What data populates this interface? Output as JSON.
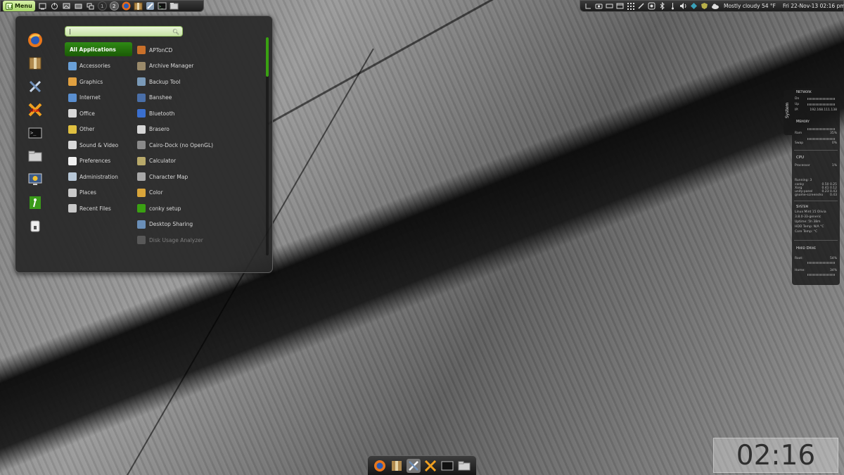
{
  "top_panel": {
    "menu_label": "Menu",
    "workspaces": [
      "1",
      "2"
    ],
    "weather": "Mostly cloudy 54 °F",
    "datetime": "Fri 22-Nov-13 02:16 pm"
  },
  "menu": {
    "search_value": "|",
    "categories": [
      {
        "label": "All Applications",
        "icon": "all-apps"
      },
      {
        "label": "Accessories",
        "icon": "accessories"
      },
      {
        "label": "Graphics",
        "icon": "graphics"
      },
      {
        "label": "Internet",
        "icon": "internet"
      },
      {
        "label": "Office",
        "icon": "office"
      },
      {
        "label": "Other",
        "icon": "other"
      },
      {
        "label": "Sound & Video",
        "icon": "sound-video"
      },
      {
        "label": "Preferences",
        "icon": "preferences"
      },
      {
        "label": "Administration",
        "icon": "administration"
      },
      {
        "label": "Places",
        "icon": "places"
      },
      {
        "label": "Recent Files",
        "icon": "recent-files"
      }
    ],
    "apps": [
      {
        "label": "APTonCD",
        "color": "#c9702a"
      },
      {
        "label": "Archive Manager",
        "color": "#9a8a6a"
      },
      {
        "label": "Backup Tool",
        "color": "#7a9ab8"
      },
      {
        "label": "Banshee",
        "color": "#4a6fa8"
      },
      {
        "label": "Bluetooth",
        "color": "#3a6fcf"
      },
      {
        "label": "Brasero",
        "color": "#d6d6d6"
      },
      {
        "label": "Cairo-Dock (no OpenGL)",
        "color": "#8a8a8a"
      },
      {
        "label": "Calculator",
        "color": "#b8a96a"
      },
      {
        "label": "Character Map",
        "color": "#a8a8a8"
      },
      {
        "label": "Color",
        "color": "#d9a53a"
      },
      {
        "label": "conky setup",
        "color": "#3aa012"
      },
      {
        "label": "Desktop Sharing",
        "color": "#6a8fb8"
      },
      {
        "label": "Disk Usage Analyzer",
        "color": "#8a8a8a"
      }
    ]
  },
  "conky": {
    "tab_label": "System",
    "network_title": "Network",
    "net_dn": "Dn",
    "net_up": "Up",
    "net_ip_label": "IP:",
    "net_ip": "192.168.111.138",
    "memory_title": "Memory",
    "ram_label": "Ram",
    "ram_value": "35%",
    "swap_label": "Swap",
    "swap_value": "0%",
    "cpu_title": "CPU",
    "processor_label": "Processor",
    "processor_value": "1%",
    "running_label": "Running: 3",
    "proc1": "conky",
    "proc1_a": "0.50",
    "proc1_b": "0.25",
    "proc2": "Xorg",
    "proc2_a": "0.41",
    "proc2_b": "0.12",
    "proc3": "unity-panel",
    "proc3_a": "0.23",
    "proc3_b": "0.43",
    "proc4": "gnome-screensho",
    "proc4_a": "0.43",
    "system_title": "System",
    "sys_os": "Linux Mint 15 Olivia",
    "sys_kernel": "3.8.0-33-generic",
    "sys_uptime": "Uptime: 5h 38m",
    "sys_hdd": "HDD Temp: N/A °C",
    "sys_core": "Core Temp: °C",
    "hdd_title": "Hard Drive",
    "root_label": "Root:",
    "root_value": "54%",
    "home_label": "Home:",
    "home_value": "34%"
  },
  "big_clock": "02:16 PM"
}
